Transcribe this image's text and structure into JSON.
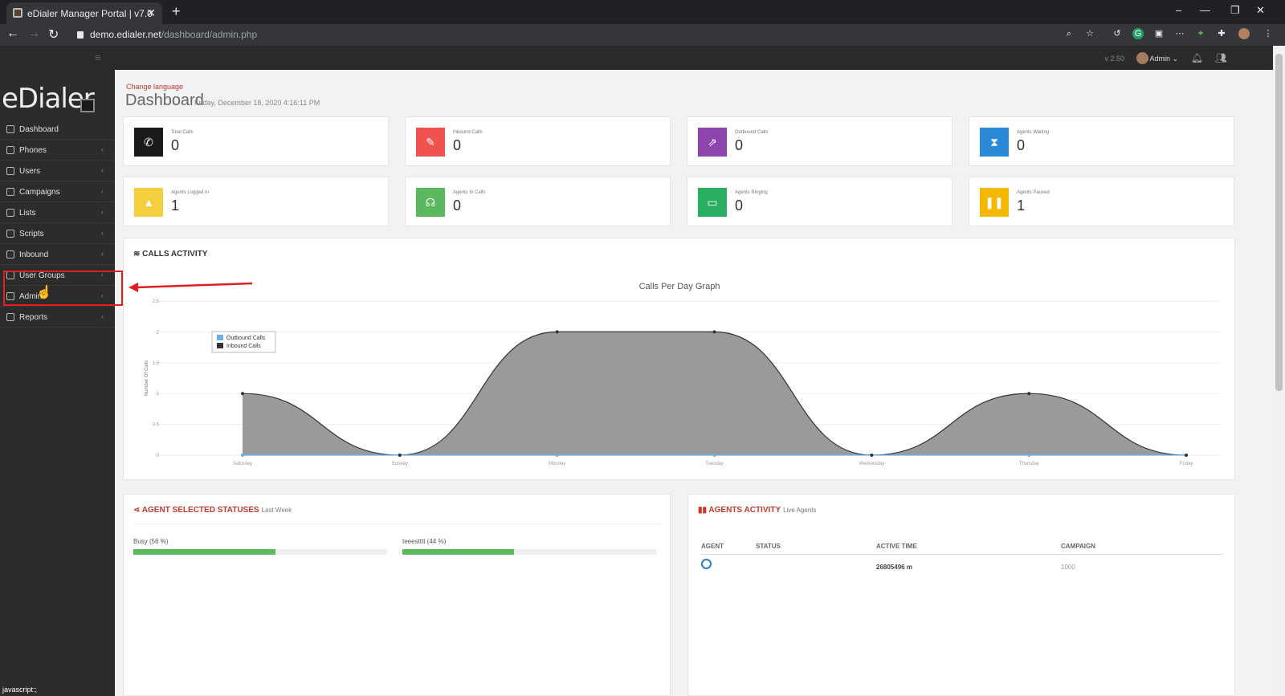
{
  "browser": {
    "tab_title": "eDialer Manager Portal | v7.0",
    "url_host": "demo.edialer.net",
    "url_path": "/dashboard/admin.php",
    "status_bar": "javascript:;"
  },
  "header": {
    "version": "v 2.50",
    "user": "Admin"
  },
  "sidebar": {
    "logo": "eDialer",
    "items": [
      {
        "label": "Dashboard",
        "icon": "home-icon"
      },
      {
        "label": "Phones",
        "icon": "phone-icon"
      },
      {
        "label": "Users",
        "icon": "user-icon"
      },
      {
        "label": "Campaigns",
        "icon": "flag-icon"
      },
      {
        "label": "Lists",
        "icon": "list-icon"
      },
      {
        "label": "Scripts",
        "icon": "doc-icon"
      },
      {
        "label": "Inbound",
        "icon": "inbound-icon"
      },
      {
        "label": "User Groups",
        "icon": "group-icon"
      },
      {
        "label": "Admin",
        "icon": "admin-icon"
      },
      {
        "label": "Reports",
        "icon": "report-icon"
      }
    ]
  },
  "page": {
    "change_language": "Change language",
    "title": "Dashboard",
    "date": "Friday, December 18, 2020 4:16:11 PM"
  },
  "stats": [
    {
      "label": "Total Calls",
      "value": "0",
      "color": "#1a1a1a",
      "icon": "phone-icon"
    },
    {
      "label": "Inbound Calls",
      "value": "0",
      "color": "#ef5350",
      "icon": "inbound-call-icon"
    },
    {
      "label": "Outbound Calls",
      "value": "0",
      "color": "#8e44ad",
      "icon": "outbound-call-icon"
    },
    {
      "label": "Agents Waiting",
      "value": "0",
      "color": "#2b8ad8",
      "icon": "hourglass-icon"
    },
    {
      "label": "Agents Logged In",
      "value": "1",
      "color": "#f4d03f",
      "icon": "bell-icon"
    },
    {
      "label": "Agents In Calls",
      "value": "0",
      "color": "#5cb85c",
      "icon": "headset-icon"
    },
    {
      "label": "Agents Ringing",
      "value": "0",
      "color": "#27ae60",
      "icon": "monitor-icon"
    },
    {
      "label": "Agents Paused",
      "value": "1",
      "color": "#f5b800",
      "icon": "pause-icon"
    }
  ],
  "calls_activity": {
    "title": "CALLS ACTIVITY"
  },
  "chart_data": {
    "type": "area",
    "title": "Calls Per Day Graph",
    "ylabel": "Number Of Calls",
    "xlabel": "",
    "categories": [
      "Saturday",
      "Sunday",
      "Monday",
      "Tuesday",
      "Wednesday",
      "Thursday",
      "Friday"
    ],
    "yticks": [
      "0",
      "0.5",
      "1",
      "1.5",
      "2",
      "2.5"
    ],
    "ylim": [
      0,
      2.5
    ],
    "legend_position": "top-left",
    "series": [
      {
        "name": "Outbound Calls",
        "values": [
          0,
          0,
          0,
          0,
          0,
          0,
          0
        ],
        "color": "#6ab0e6"
      },
      {
        "name": "Inbound Calls",
        "values": [
          1,
          0,
          2,
          2,
          0,
          1,
          0
        ],
        "color": "#333333"
      }
    ]
  },
  "agent_statuses": {
    "title": "AGENT SELECTED STATUSES",
    "subtitle": "Last Week",
    "items": [
      {
        "label": "Busy (56 %)",
        "percent": 56
      },
      {
        "label": "teeestttt (44 %)",
        "percent": 44
      }
    ]
  },
  "agents_activity": {
    "title": "AGENTS ACTIVITY",
    "subtitle": "Live Agents",
    "columns": [
      "AGENT",
      "STATUS",
      "ACTIVE TIME",
      "CAMPAIGN"
    ],
    "rows": [
      {
        "status": "",
        "active_time": "26805496 m",
        "campaign": "1000"
      }
    ]
  }
}
